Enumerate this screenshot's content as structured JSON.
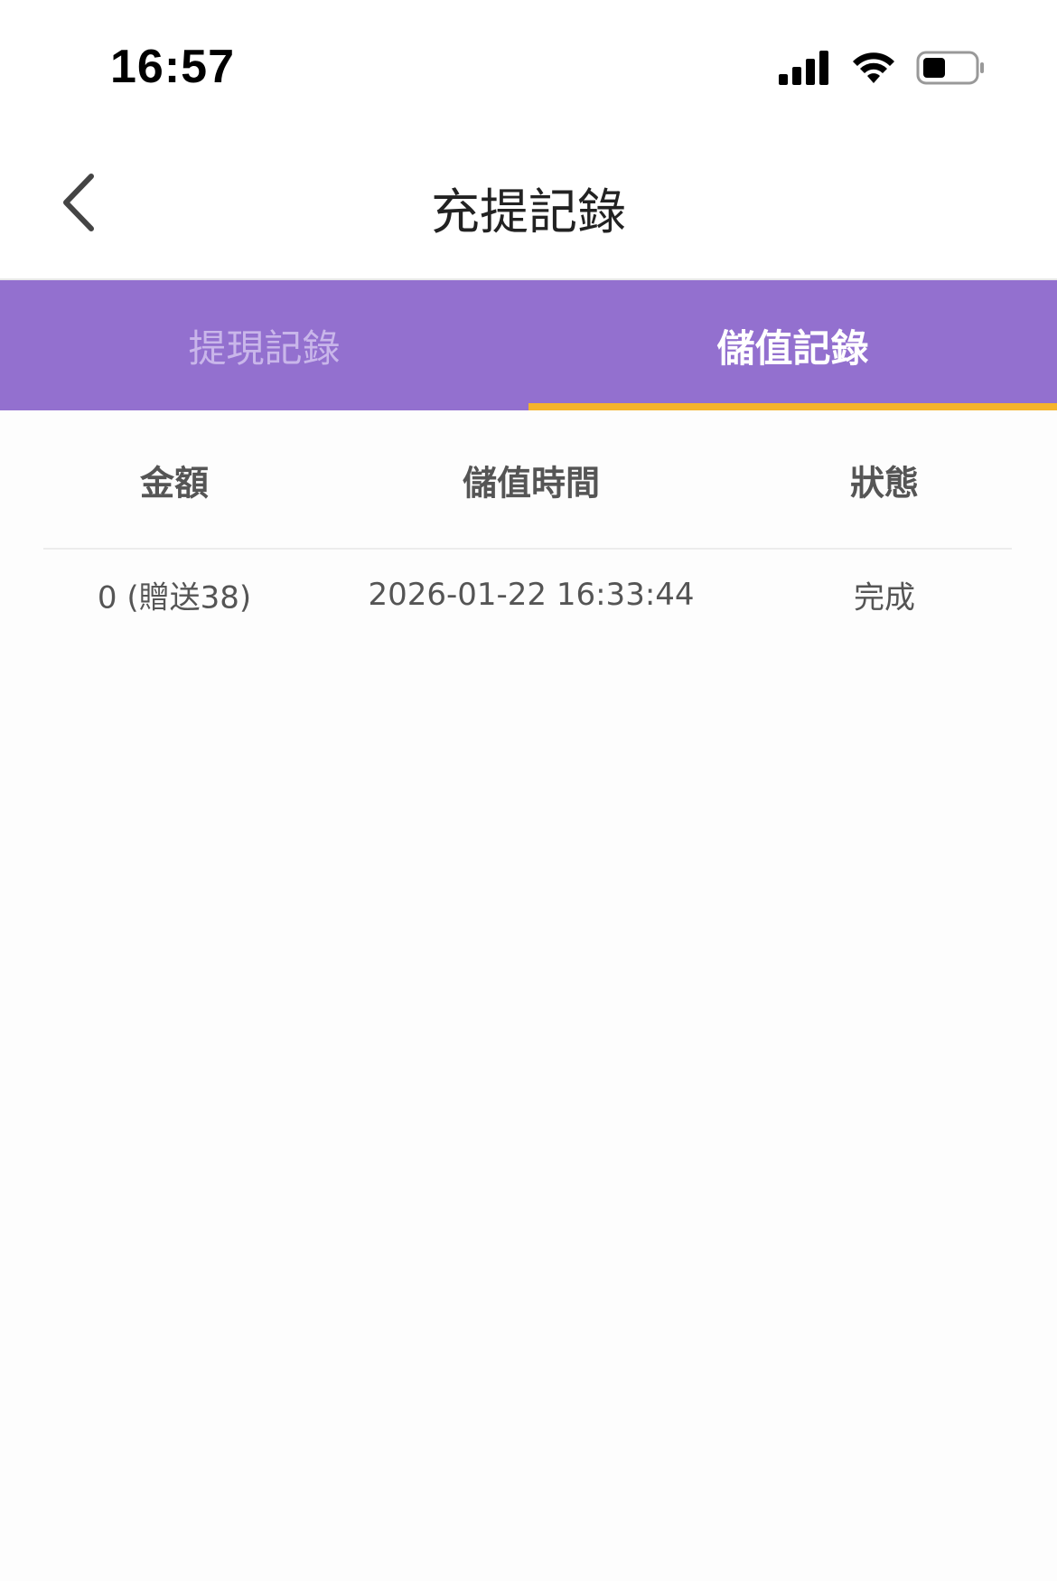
{
  "status_bar": {
    "time": "16:57",
    "icons": [
      "signal-icon",
      "wifi-icon",
      "battery-icon"
    ]
  },
  "nav": {
    "back_icon": "chevron-left-icon",
    "title": "充提記錄"
  },
  "tabs": [
    {
      "label": "提現記錄",
      "active": false
    },
    {
      "label": "儲值記錄",
      "active": true
    }
  ],
  "table": {
    "headers": [
      "金額",
      "儲值時間",
      "狀態"
    ],
    "rows": [
      {
        "amount": "0 (贈送38)",
        "time": "2026-01-22 16:33:44",
        "status": "完成"
      }
    ]
  },
  "colors": {
    "tab_bar": "#9370cf",
    "tab_indicator": "#f5b32c",
    "tab_inactive_text": "#c9b6ea"
  }
}
